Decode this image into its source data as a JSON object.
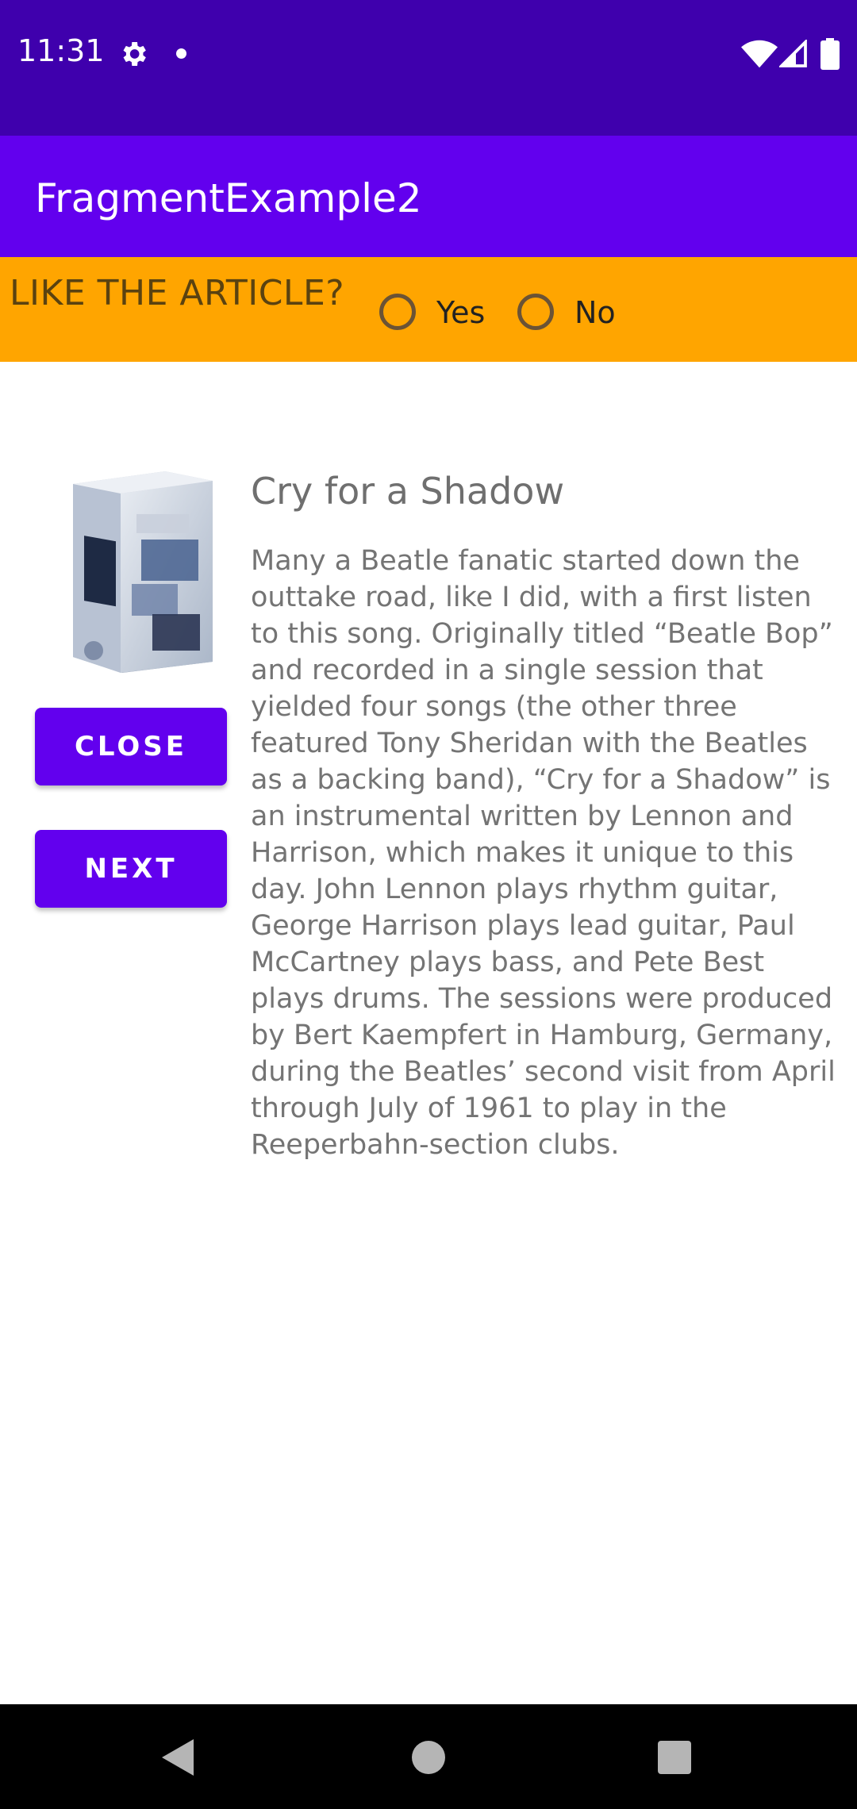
{
  "status_bar": {
    "time": "11:31",
    "icons": [
      "gear-icon",
      "notification-dot-icon",
      "wifi-icon",
      "signal-icon",
      "battery-icon"
    ]
  },
  "app_bar": {
    "title": "FragmentExample2",
    "color": "#6200ee"
  },
  "feedback": {
    "question": "LIKE THE ARTICLE?",
    "options": [
      "Yes",
      "No"
    ],
    "selected": null,
    "background": "#ffa500"
  },
  "article": {
    "cover_icon": "album-box-set-image",
    "title": "Cry for a Shadow",
    "body": "Many a Beatle fanatic started down the outtake road, like I did, with a first listen to this song. Originally titled “Beatle Bop” and recorded in a single session that yielded four songs (the other three featured Tony Sheridan with the Beatles as a backing band), “Cry for a Shadow” is an instrumental written by Lennon and Harrison, which makes it unique to this day. John Lennon plays rhythm guitar, George Harrison plays lead guitar, Paul McCartney plays bass, and Pete Best plays drums. The sessions were produced by Bert Kaempfert in Hamburg, Germany, during the Beatles’ second visit from April through July of 1961 to play in the Reeperbahn-section clubs."
  },
  "buttons": {
    "close_label": "CLOSE",
    "next_label": "NEXT",
    "color": "#6200ee"
  },
  "nav_bar": {
    "icons": [
      "back-icon",
      "home-icon",
      "recents-icon"
    ]
  }
}
